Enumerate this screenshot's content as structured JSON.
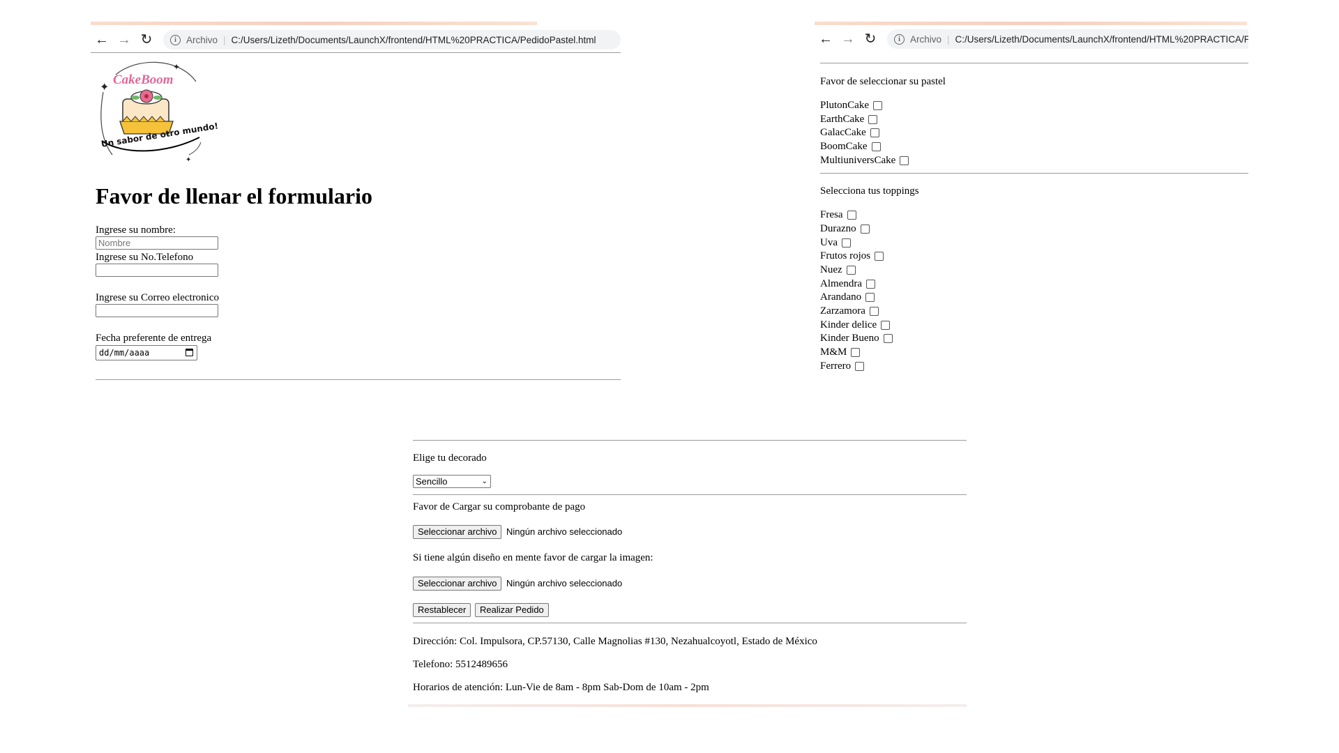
{
  "browser": {
    "archivo_label": "Archivo",
    "url_left": "C:/Users/Lizeth/Documents/LaunchX/frontend/HTML%20PRACTICA/PedidoPastel.html",
    "url_right": "C:/Users/Lizeth/Documents/LaunchX/frontend/HTML%20PRACTICA/P"
  },
  "logo": {
    "name": "CakeBoom",
    "slogan": "Un sabor de otro mundo!"
  },
  "form": {
    "heading": "Favor de llenar el formulario",
    "name_label": "Ingrese su nombre:",
    "name_placeholder": "Nombre",
    "phone_label": "Ingrese su No.Telefono",
    "email_label": "Ingrese su Correo electronico",
    "date_label": "Fecha preferente de entrega",
    "date_placeholder": "dd/mm/aaaa"
  },
  "cakes": {
    "label": "Favor de seleccionar su pastel",
    "options": [
      "PlutonCake",
      "EarthCake",
      "GalacCake",
      "BoomCake",
      "MultiuniversCake"
    ]
  },
  "toppings": {
    "label": "Selecciona tus toppings",
    "options": [
      "Fresa",
      "Durazno",
      "Uva",
      "Frutos rojos",
      "Nuez",
      "Almendra",
      "Arandano",
      "Zarzamora",
      "Kinder delice",
      "Kinder Bueno",
      "M&M",
      "Ferrero"
    ]
  },
  "decor": {
    "label": "Elige tu decorado",
    "selected": "Sencillo"
  },
  "uploads": {
    "payment_label": "Favor de Cargar su comprobante de pago",
    "design_label": "Si tiene algún diseño en mente favor de cargar la imagen:",
    "button_label": "Seleccionar archivo",
    "no_file": "Ningún archivo seleccionado"
  },
  "actions": {
    "reset": "Restablecer",
    "submit": "Realizar Pedido"
  },
  "footer": {
    "address": "Dirección: Col. Impulsora, CP.57130, Calle Magnolias #130, Nezahualcoyotl, Estado de México",
    "phone": "Telefono: 5512489656",
    "hours": "Horarios de atención: Lun-Vie de 8am - 8pm Sab-Dom de 10am - 2pm"
  }
}
